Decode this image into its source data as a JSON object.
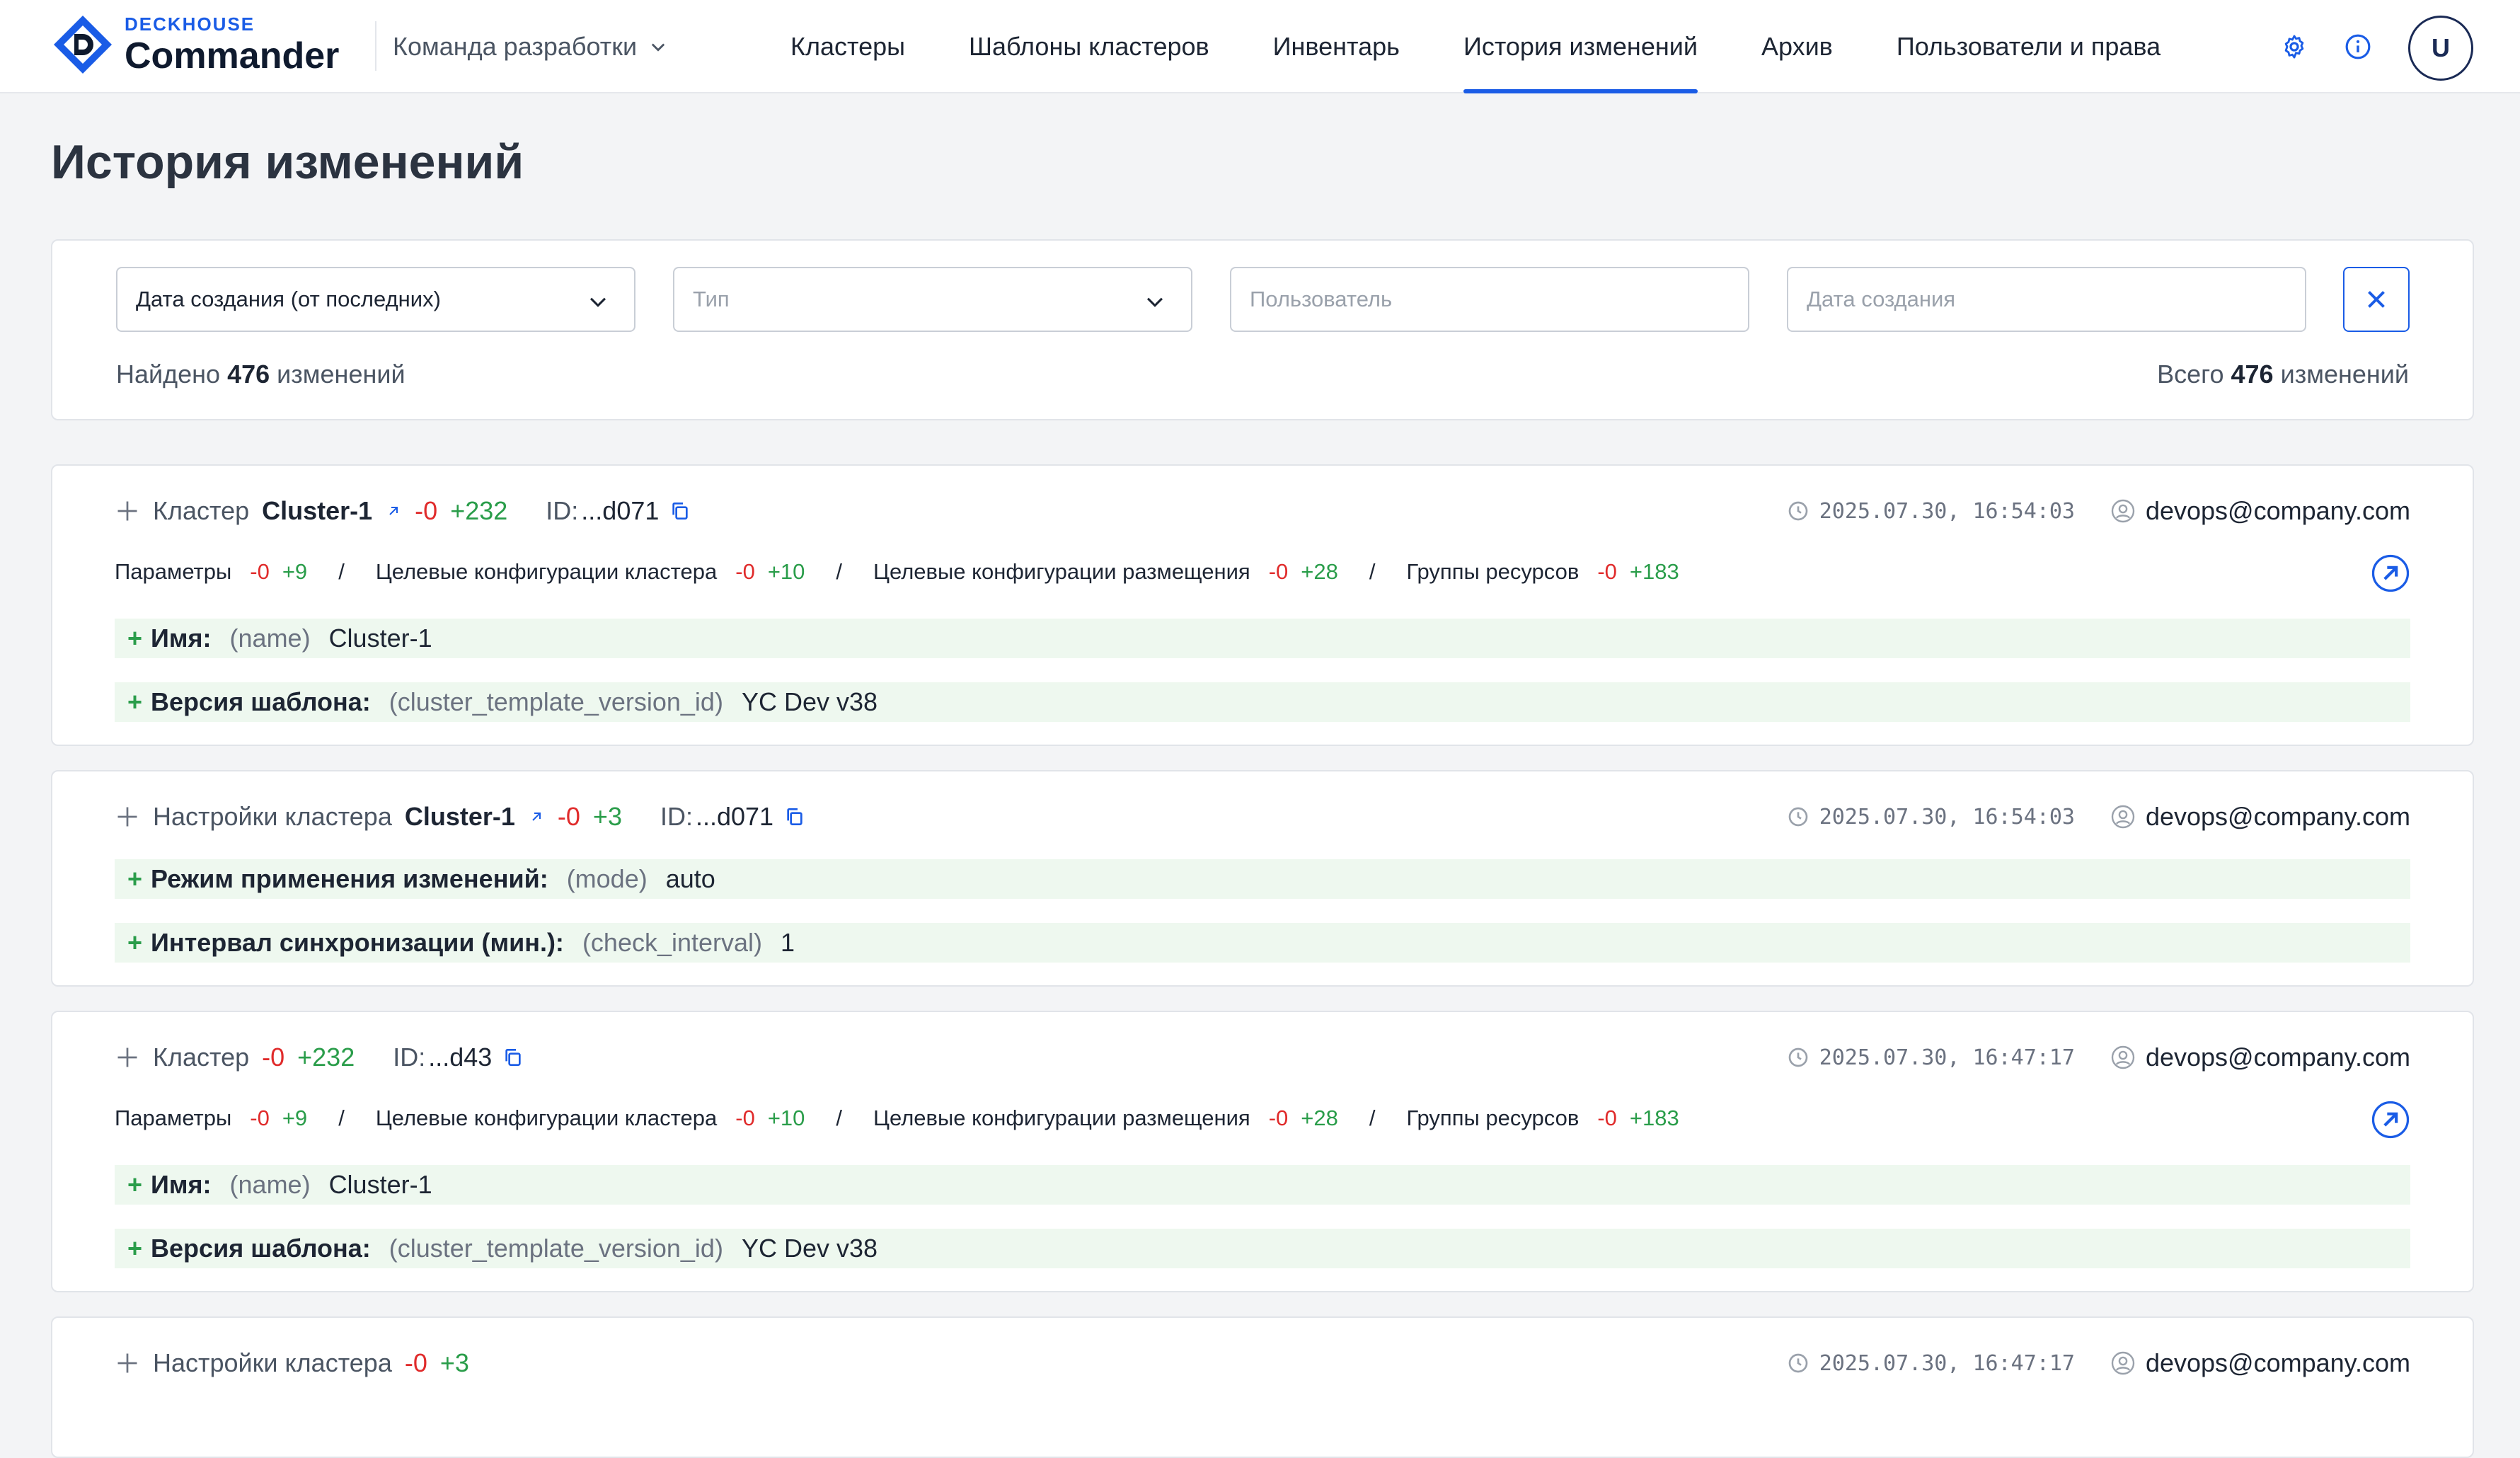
{
  "brand": {
    "top": "DECKHOUSE",
    "main": "Commander",
    "accent": "#1a5ce6"
  },
  "team": {
    "label": "Команда разработки"
  },
  "nav": {
    "tabs": [
      "Кластеры",
      "Шаблоны кластеров",
      "Инвентарь",
      "История изменений",
      "Архив",
      "Пользователи и права"
    ],
    "active_index": 3
  },
  "user_initial": "U",
  "page_title": "История изменений",
  "filters": {
    "sort_value": "Дата создания (от последних)",
    "type_placeholder": "Тип",
    "user_placeholder": "Пользователь",
    "date_placeholder": "Дата создания",
    "found_prefix": "Найдено",
    "found_count": "476",
    "found_suffix": "изменений",
    "total_prefix": "Всего",
    "total_count": "476",
    "total_suffix": "изменений"
  },
  "entries": [
    {
      "kind": "Кластер",
      "object": "Cluster-1",
      "minus": "-0",
      "plus": "+232",
      "id_label": "ID:",
      "id_value": "...d071",
      "timestamp": "2025.07.30, 16:54:03",
      "user": "devops@company.com",
      "sections": [
        {
          "name": "Параметры",
          "minus": "-0",
          "plus": "+9"
        },
        {
          "name": "Целевые конфигурации кластера",
          "minus": "-0",
          "plus": "+10"
        },
        {
          "name": "Целевые конфигурации размещения",
          "minus": "-0",
          "plus": "+28"
        },
        {
          "name": "Группы ресурсов",
          "minus": "-0",
          "plus": "+183"
        }
      ],
      "fields": [
        {
          "label": "Имя:",
          "key": "(name)",
          "value": "Cluster-1"
        },
        {
          "label": "Версия шаблона:",
          "key": "(cluster_template_version_id)",
          "value": "YC Dev v38"
        }
      ]
    },
    {
      "kind": "Настройки кластера",
      "object": "Cluster-1",
      "minus": "-0",
      "plus": "+3",
      "id_label": "ID:",
      "id_value": "...d071",
      "timestamp": "2025.07.30, 16:54:03",
      "user": "devops@company.com",
      "fields": [
        {
          "label": "Режим применения изменений:",
          "key": "(mode)",
          "value": "auto"
        },
        {
          "label": "Интервал синхронизации (мин.):",
          "key": "(check_interval)",
          "value": "1"
        }
      ]
    },
    {
      "kind": "Кластер",
      "minus": "-0",
      "plus": "+232",
      "id_label": "ID:",
      "id_value": "...d43",
      "timestamp": "2025.07.30, 16:47:17",
      "user": "devops@company.com",
      "sections": [
        {
          "name": "Параметры",
          "minus": "-0",
          "plus": "+9"
        },
        {
          "name": "Целевые конфигурации кластера",
          "minus": "-0",
          "plus": "+10"
        },
        {
          "name": "Целевые конфигурации размещения",
          "minus": "-0",
          "plus": "+28"
        },
        {
          "name": "Группы ресурсов",
          "minus": "-0",
          "plus": "+183"
        }
      ],
      "fields": [
        {
          "label": "Имя:",
          "key": "(name)",
          "value": "Cluster-1"
        },
        {
          "label": "Версия шаблона:",
          "key": "(cluster_template_version_id)",
          "value": "YC Dev v38"
        }
      ]
    },
    {
      "kind": "Настройки кластера",
      "minus": "-0",
      "plus": "+3",
      "timestamp": "2025.07.30, 16:47:17",
      "user": "devops@company.com"
    }
  ]
}
